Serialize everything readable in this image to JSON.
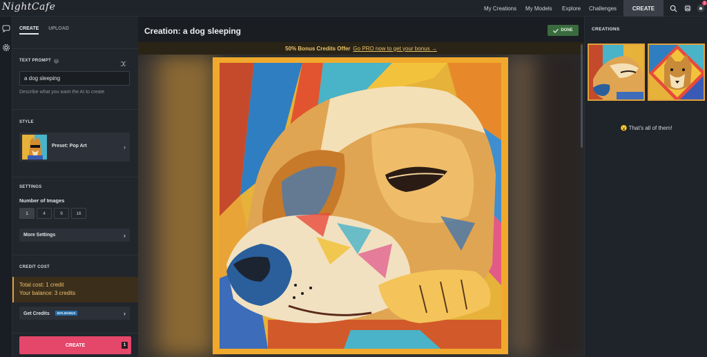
{
  "app": {
    "logo": "NightCafe"
  },
  "nav": {
    "items": [
      "My Creations",
      "My Models",
      "Explore",
      "Challenges"
    ],
    "create_label": "CREATE",
    "notification_count": "2"
  },
  "left": {
    "tabs": [
      "CREATE",
      "UPLOAD"
    ],
    "text_prompt": {
      "label": "TEXT PROMPT",
      "value": "a dog sleeping",
      "help": "Describe what you want the AI to create"
    },
    "style": {
      "label": "STYLE",
      "preset": "Preset: Pop Art"
    },
    "settings": {
      "label": "SETTINGS",
      "num_images_label": "Number of Images",
      "options": [
        "1",
        "4",
        "9",
        "16"
      ],
      "selected": "1",
      "more_settings": "More Settings"
    },
    "credit": {
      "label": "CREDIT COST",
      "total": "Total cost: 1 credit",
      "balance": "Your balance: 3 credits",
      "get_credits": "Get Credits",
      "bonus_badge": "50% BONUS"
    },
    "create_button": "CREATE",
    "create_count": "1"
  },
  "main": {
    "title": "Creation: a dog sleeping",
    "done_label": "DONE",
    "promo_bold": "50% Bonus Credits Offer",
    "promo_link": "Go PRO now to get your bonus →"
  },
  "right": {
    "title": "CREATIONS",
    "end_message": "That's all of them!",
    "end_emoji": "😮"
  },
  "colors": {
    "accent": "#e5476a",
    "promo": "#e9c46a",
    "done": "#3a6b3e",
    "frame": "#e0a23b"
  }
}
